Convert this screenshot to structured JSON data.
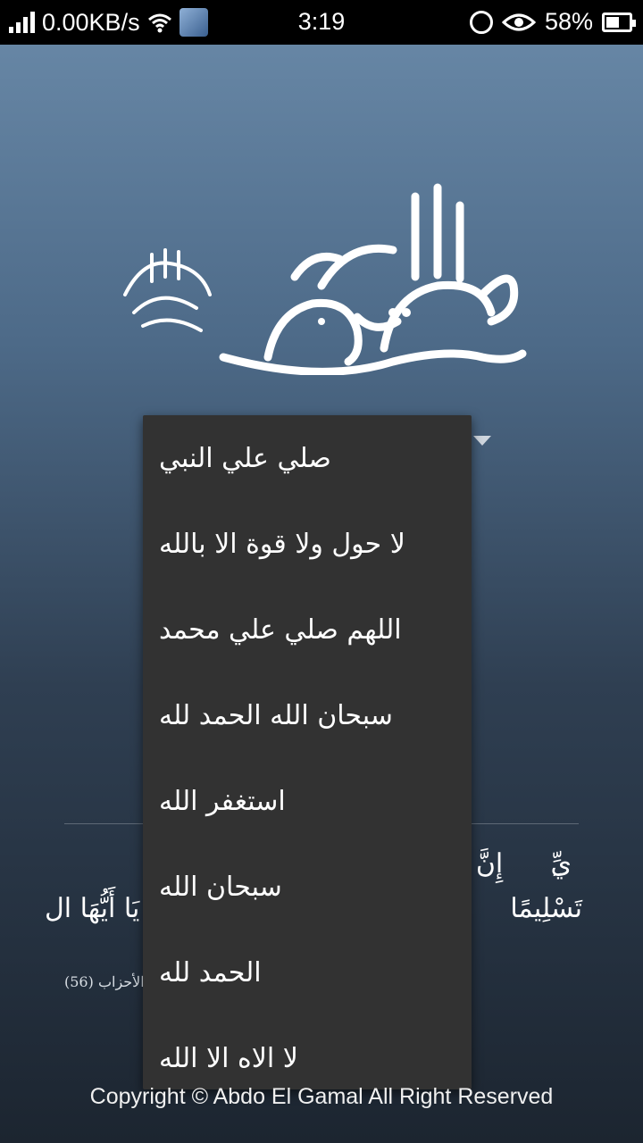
{
  "status_bar": {
    "network_speed": "0.00KB/s",
    "time": "3:19",
    "battery_percent": "58%",
    "battery_level": 0.58,
    "icons": [
      "signal-icon",
      "wifi-icon",
      "notification-thumbnail-icon",
      "alarm-icon",
      "eye-icon",
      "battery-icon"
    ]
  },
  "header": {
    "calligraphy_text": "محمد رسول الله",
    "calligraphy_blessing": "صلى الله عليه وسلم"
  },
  "dropdown": {
    "items": [
      "صلي علي النبي",
      "لا حول ولا قوة الا بالله",
      "اللهم صلي علي محمد",
      "سبحان الله الحمد لله",
      "استغفر الله",
      "سبحان الله",
      "الحمد لله",
      "لا الاه الا الله"
    ]
  },
  "verse": {
    "line1_right": "إِنَّ ا",
    "line1_left": "ِيِّ",
    "line2_right": "يَا أَيُّهَا ال",
    "line2_left": "تَسْلِيمًا",
    "reference": "الأحزاب (56)"
  },
  "footer": {
    "copyright": "Copyright © Abdo El Gamal All Right Reserved"
  }
}
